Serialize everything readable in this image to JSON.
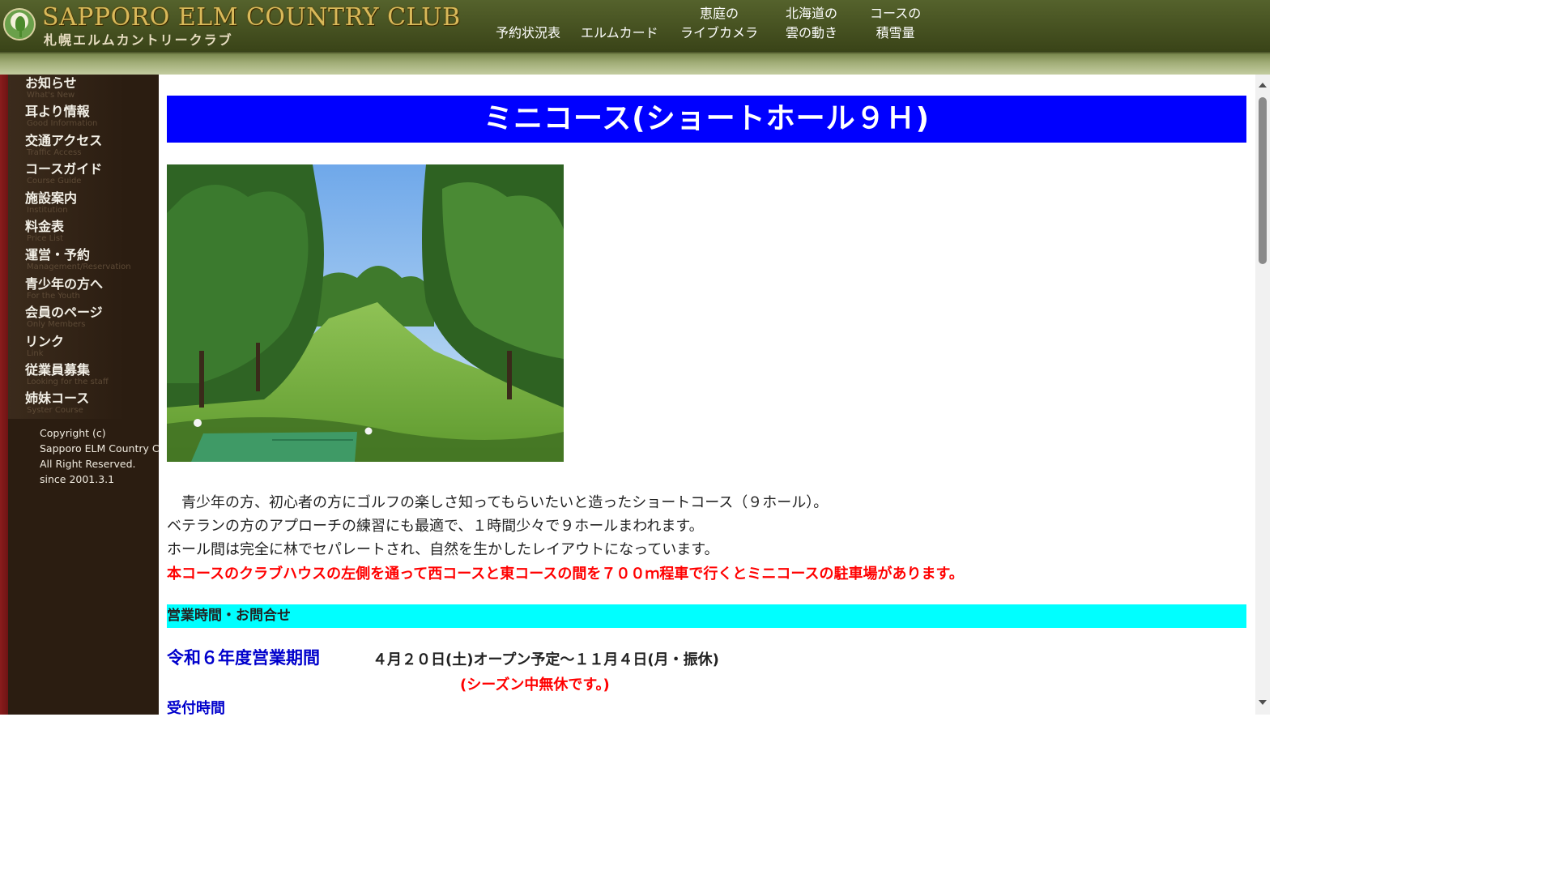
{
  "header": {
    "logo_title": "SAPPORO ELM COUNTRY CLUB",
    "logo_subtitle": "札幌エルムカントリークラブ",
    "nav": [
      {
        "line1": "予約状況表",
        "line2": ""
      },
      {
        "line1": "エルムカード",
        "line2": ""
      },
      {
        "line1": "恵庭の",
        "line2": "ライブカメラ"
      },
      {
        "line1": "北海道の",
        "line2": "雲の動き"
      },
      {
        "line1": "コースの",
        "line2": "積雪量"
      }
    ]
  },
  "sidebar": {
    "items": [
      {
        "label": "お知らせ",
        "sub": "What's New"
      },
      {
        "label": "耳より情報",
        "sub": "Good Information"
      },
      {
        "label": "交通アクセス",
        "sub": "Traffic Access"
      },
      {
        "label": "コースガイド",
        "sub": "Course Guide"
      },
      {
        "label": "施設案内",
        "sub": "Institution"
      },
      {
        "label": "料金表",
        "sub": "Price List"
      },
      {
        "label": "運営・予約",
        "sub": "Management/Reservation"
      },
      {
        "label": "青少年の方へ",
        "sub": "For the Youth"
      },
      {
        "label": "会員のページ",
        "sub": "Only Members"
      },
      {
        "label": "リンク",
        "sub": "Link"
      },
      {
        "label": "従業員募集",
        "sub": "Looking for the staff"
      },
      {
        "label": "姉妹コース",
        "sub": "Syster Course"
      }
    ],
    "copyright": {
      "line1": "Copyright (c)",
      "line2": "Sapporo ELM Country Club",
      "line3": "All Right Reserved.",
      "line4": "since 2001.3.1"
    }
  },
  "main": {
    "title": "ミニコース(ショートホール９Ｈ)",
    "intro": {
      "line1": "　青少年の方、初心者の方にゴルフの楽しさ知ってもらいたいと造ったショートコース（９ホール）。",
      "line2": "ベテランの方のアプローチの練習にも最適で、１時間少々で９ホールまわれます。",
      "line3": "ホール間は完全に林でセパレートされ、自然を生かしたレイアウトになっています。",
      "line4": "本コースのクラブハウスの左側を通って西コースと東コースの間を７００ｍ程車で行くとミニコースの駐車場があります。"
    },
    "hours_header": "営業時間・お問合せ",
    "season_label": "令和６年度営業期間",
    "season_dates": "４月２０日(土)オープン予定～１１月４日(月・振休)",
    "season_note": "(シーズン中無休です。)",
    "reception_label": "受付時間"
  },
  "colors": {
    "title_bg": "#0000ff",
    "hours_header_bg": "#00ffff",
    "red_text": "#ff0000",
    "blue_label": "#0000cc",
    "sidebar_bg": "#2b1d11",
    "sidebar_stripe": "#8a1c1c",
    "header_bg": "#4a5624",
    "logo_gold": "#d9b95a"
  },
  "icons": {
    "logo": "elm-leaf-emblem-icon",
    "scroll_up": "scroll-up-arrow-icon",
    "scroll_down": "scroll-down-arrow-icon"
  }
}
